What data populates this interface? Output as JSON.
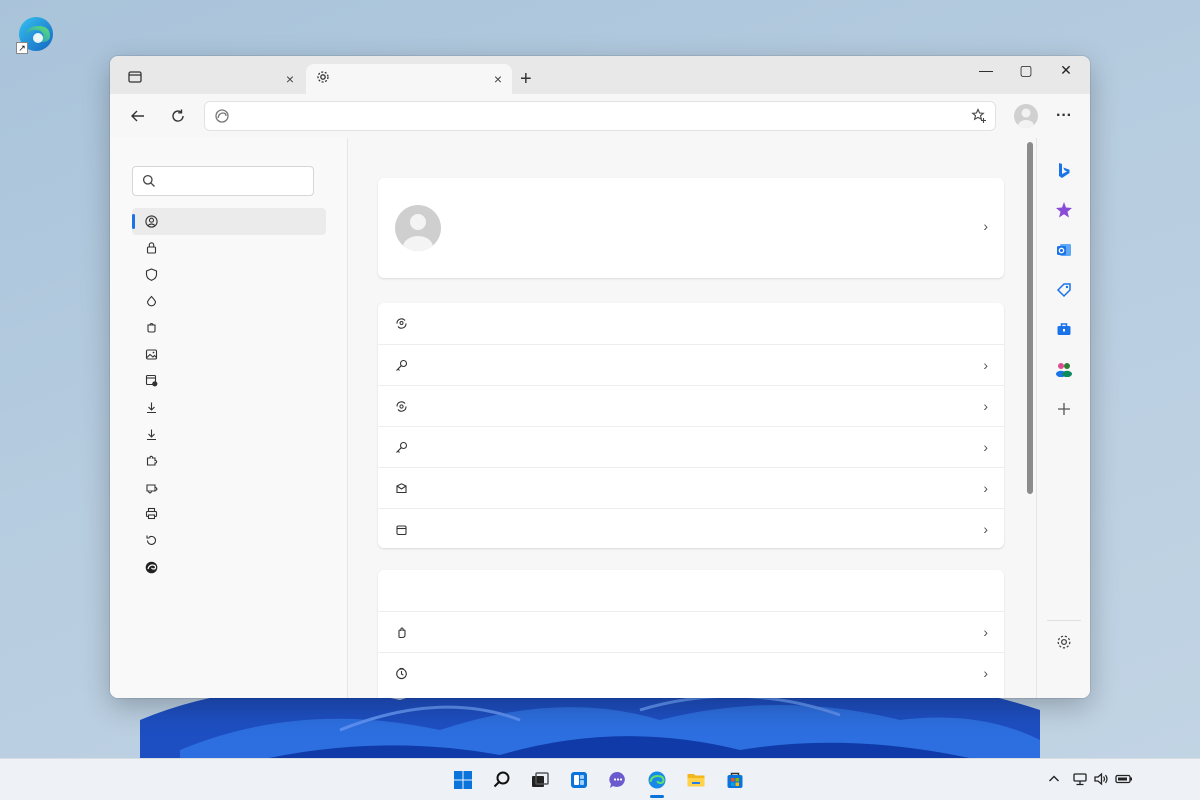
{
  "desktop": {
    "shortcut_icon": "edge-logo-icon",
    "shortcut_overlay": "↗"
  },
  "browser": {
    "tabs": [
      {
        "icon": "window-icon",
        "label": "",
        "close": "×"
      },
      {
        "icon": "gear-icon",
        "label": "",
        "close": "×"
      }
    ],
    "new_tab_label": "+",
    "window_controls": {
      "minimize": "—",
      "maximize": "▢",
      "close": "✕"
    },
    "toolbar": {
      "back_icon": "arrow-left-icon",
      "refresh_icon": "refresh-icon",
      "address_value": "",
      "address_placeholder": "",
      "favorites_icon": "star-plus-icon",
      "profile_icon": "avatar-icon",
      "more_label": "···"
    }
  },
  "settings": {
    "search": {
      "value": "",
      "placeholder": ""
    },
    "nav": [
      {
        "icon": "profile-icon",
        "label": "",
        "selected": true
      },
      {
        "icon": "lock-icon",
        "label": ""
      },
      {
        "icon": "shield-icon",
        "label": ""
      },
      {
        "icon": "flame-icon",
        "label": ""
      },
      {
        "icon": "start-icon",
        "label": ""
      },
      {
        "icon": "picture-icon",
        "label": ""
      },
      {
        "icon": "permissions-icon",
        "label": ""
      },
      {
        "icon": "download-icon",
        "label": ""
      },
      {
        "icon": "download-alt-icon",
        "label": ""
      },
      {
        "icon": "puzzle-icon",
        "label": ""
      },
      {
        "icon": "family-icon",
        "label": ""
      },
      {
        "icon": "printer-icon",
        "label": ""
      },
      {
        "icon": "reset-icon",
        "label": ""
      },
      {
        "icon": "edge-icon",
        "label": ""
      }
    ],
    "profile_card": {
      "name": "",
      "email": "",
      "chevron": "›"
    },
    "account_rows": [
      {
        "icon": "sync-icon",
        "label": ""
      },
      {
        "icon": "key-icon",
        "label": "",
        "chevron": "›"
      },
      {
        "icon": "personal-info-icon",
        "label": "",
        "chevron": "›"
      },
      {
        "icon": "key-alt-icon",
        "label": "",
        "chevron": "›"
      },
      {
        "icon": "wallet-icon",
        "label": "",
        "chevron": "›"
      },
      {
        "icon": "bag-icon",
        "label": "",
        "chevron": "›"
      }
    ],
    "section_title": "",
    "more_rows": [
      {
        "icon": "hand-icon",
        "label": "",
        "chevron": "›"
      },
      {
        "icon": "clock-icon",
        "label": "",
        "chevron": "›"
      }
    ]
  },
  "sidebar_apps": [
    {
      "icon": "bing-icon",
      "color": "#1a73e8"
    },
    {
      "icon": "copilot-star-icon",
      "color": "#8a4bd6"
    },
    {
      "icon": "outlook-icon",
      "color": "#1a73e8"
    },
    {
      "icon": "tag-icon",
      "color": "#1a73e8"
    },
    {
      "icon": "toolbox-icon",
      "color": "#1a73e8"
    },
    {
      "icon": "people-icon",
      "color": "#2e7d32"
    },
    {
      "icon": "add-icon",
      "color": "#555555"
    },
    {
      "icon": "gear-icon",
      "color": "#555555"
    }
  ],
  "taskbar": {
    "icons": [
      "windows-start-icon",
      "search-icon",
      "task-view-icon",
      "widgets-icon",
      "chat-icon",
      "edge-icon",
      "file-explorer-icon",
      "store-icon"
    ],
    "tray": [
      "chevron-up-icon",
      "network-icon",
      "volume-icon",
      "battery-icon"
    ]
  }
}
